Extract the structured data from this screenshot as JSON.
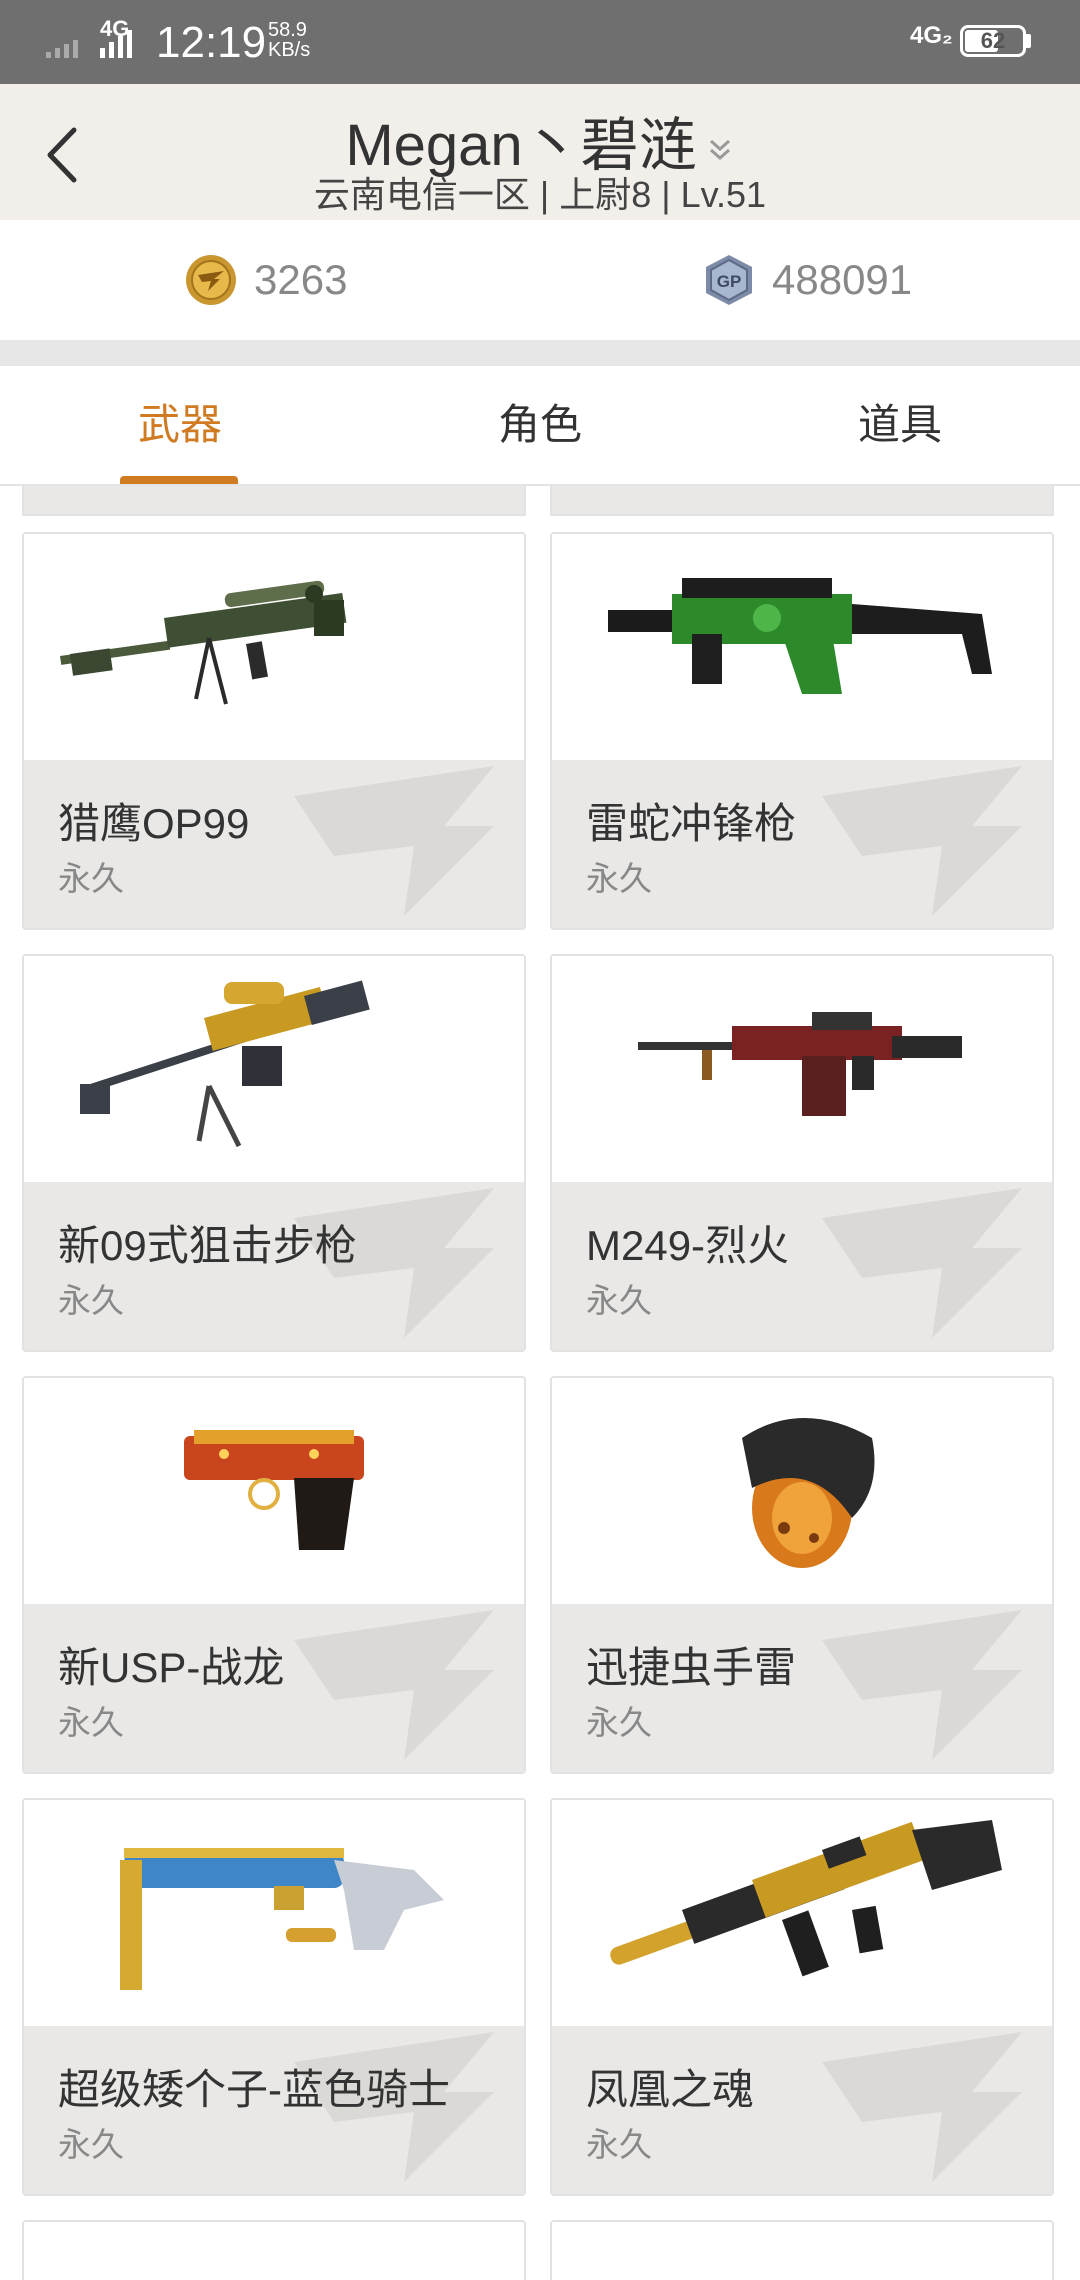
{
  "status_bar": {
    "network_left": "4G",
    "time": "12:19",
    "speed_value": "58.9",
    "speed_unit": "KB/s",
    "network_right": "4G₂",
    "battery": "62"
  },
  "header": {
    "title": "Megan丶碧涟",
    "subtitle": "云南电信一区 | 上尉8 | Lv.51"
  },
  "currency": {
    "coin_icon": "cf-coin-icon",
    "coin_value": "3263",
    "gp_icon": "gp-coin-icon",
    "gp_label": "GP",
    "gp_value": "488091"
  },
  "tabs": [
    {
      "label": "武器",
      "active": true
    },
    {
      "label": "角色",
      "active": false
    },
    {
      "label": "道具",
      "active": false
    }
  ],
  "items": [
    {
      "name": "猎鹰OP99",
      "duration": "永久",
      "icon": "sniper-rifle-green"
    },
    {
      "name": "雷蛇冲锋枪",
      "duration": "永久",
      "icon": "smg-green-razer"
    },
    {
      "name": "新09式狙击步枪",
      "duration": "永久",
      "icon": "sniper-rifle-gold"
    },
    {
      "name": "M249-烈火",
      "duration": "永久",
      "icon": "machine-gun-red"
    },
    {
      "name": "新USP-战龙",
      "duration": "永久",
      "icon": "pistol-dragon"
    },
    {
      "name": "迅捷虫手雷",
      "duration": "永久",
      "icon": "grenade-bug"
    },
    {
      "name": "超级矮个子-蓝色骑士",
      "duration": "永久",
      "icon": "shotgun-blue"
    },
    {
      "name": "凤凰之魂",
      "duration": "永久",
      "icon": "rifle-phoenix"
    }
  ],
  "colors": {
    "accent": "#d07a22",
    "status_bar": "#6f6f6f",
    "header_bg": "#f2efea",
    "card_footer": "#eae8e6"
  }
}
